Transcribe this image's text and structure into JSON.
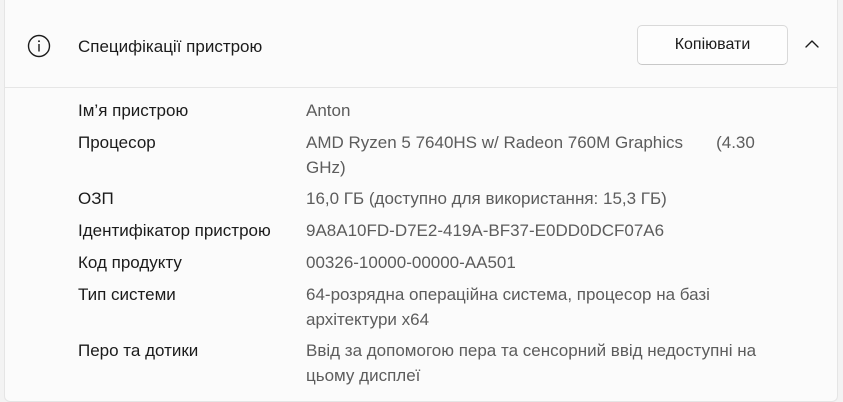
{
  "header": {
    "title": "Специфікації пристрою",
    "copy_label": "Копіювати",
    "info_icon": "info-icon",
    "collapse_icon": "chevron-up-icon"
  },
  "specs": [
    {
      "label": "Ім’я пристрою",
      "value": "Anton"
    },
    {
      "label": "Процесор",
      "value": "AMD Ryzen 5 7640HS w/ Radeon 760M Graphics       (4.30\nGHz)"
    },
    {
      "label": "ОЗП",
      "value": "16,0 ГБ (доступно для використання: 15,3 ГБ)"
    },
    {
      "label": "Ідентифікатор пристрою",
      "value": "9A8A10FD-D7E2-419A-BF37-E0DD0DCF07A6"
    },
    {
      "label": "Код продукту",
      "value": "00326-10000-00000-AA501"
    },
    {
      "label": "Тип системи",
      "value": "64-розрядна операційна система, процесор на базі\nархітектури x64"
    },
    {
      "label": "Перо та дотики",
      "value": "Ввід за допомогою пера та сенсорний ввід недоступні на\nцьому дисплеї"
    }
  ],
  "colors": {
    "label_text": "#1b1b1b",
    "value_text": "#5c5c5c",
    "card_background": "#fbfbfb"
  }
}
